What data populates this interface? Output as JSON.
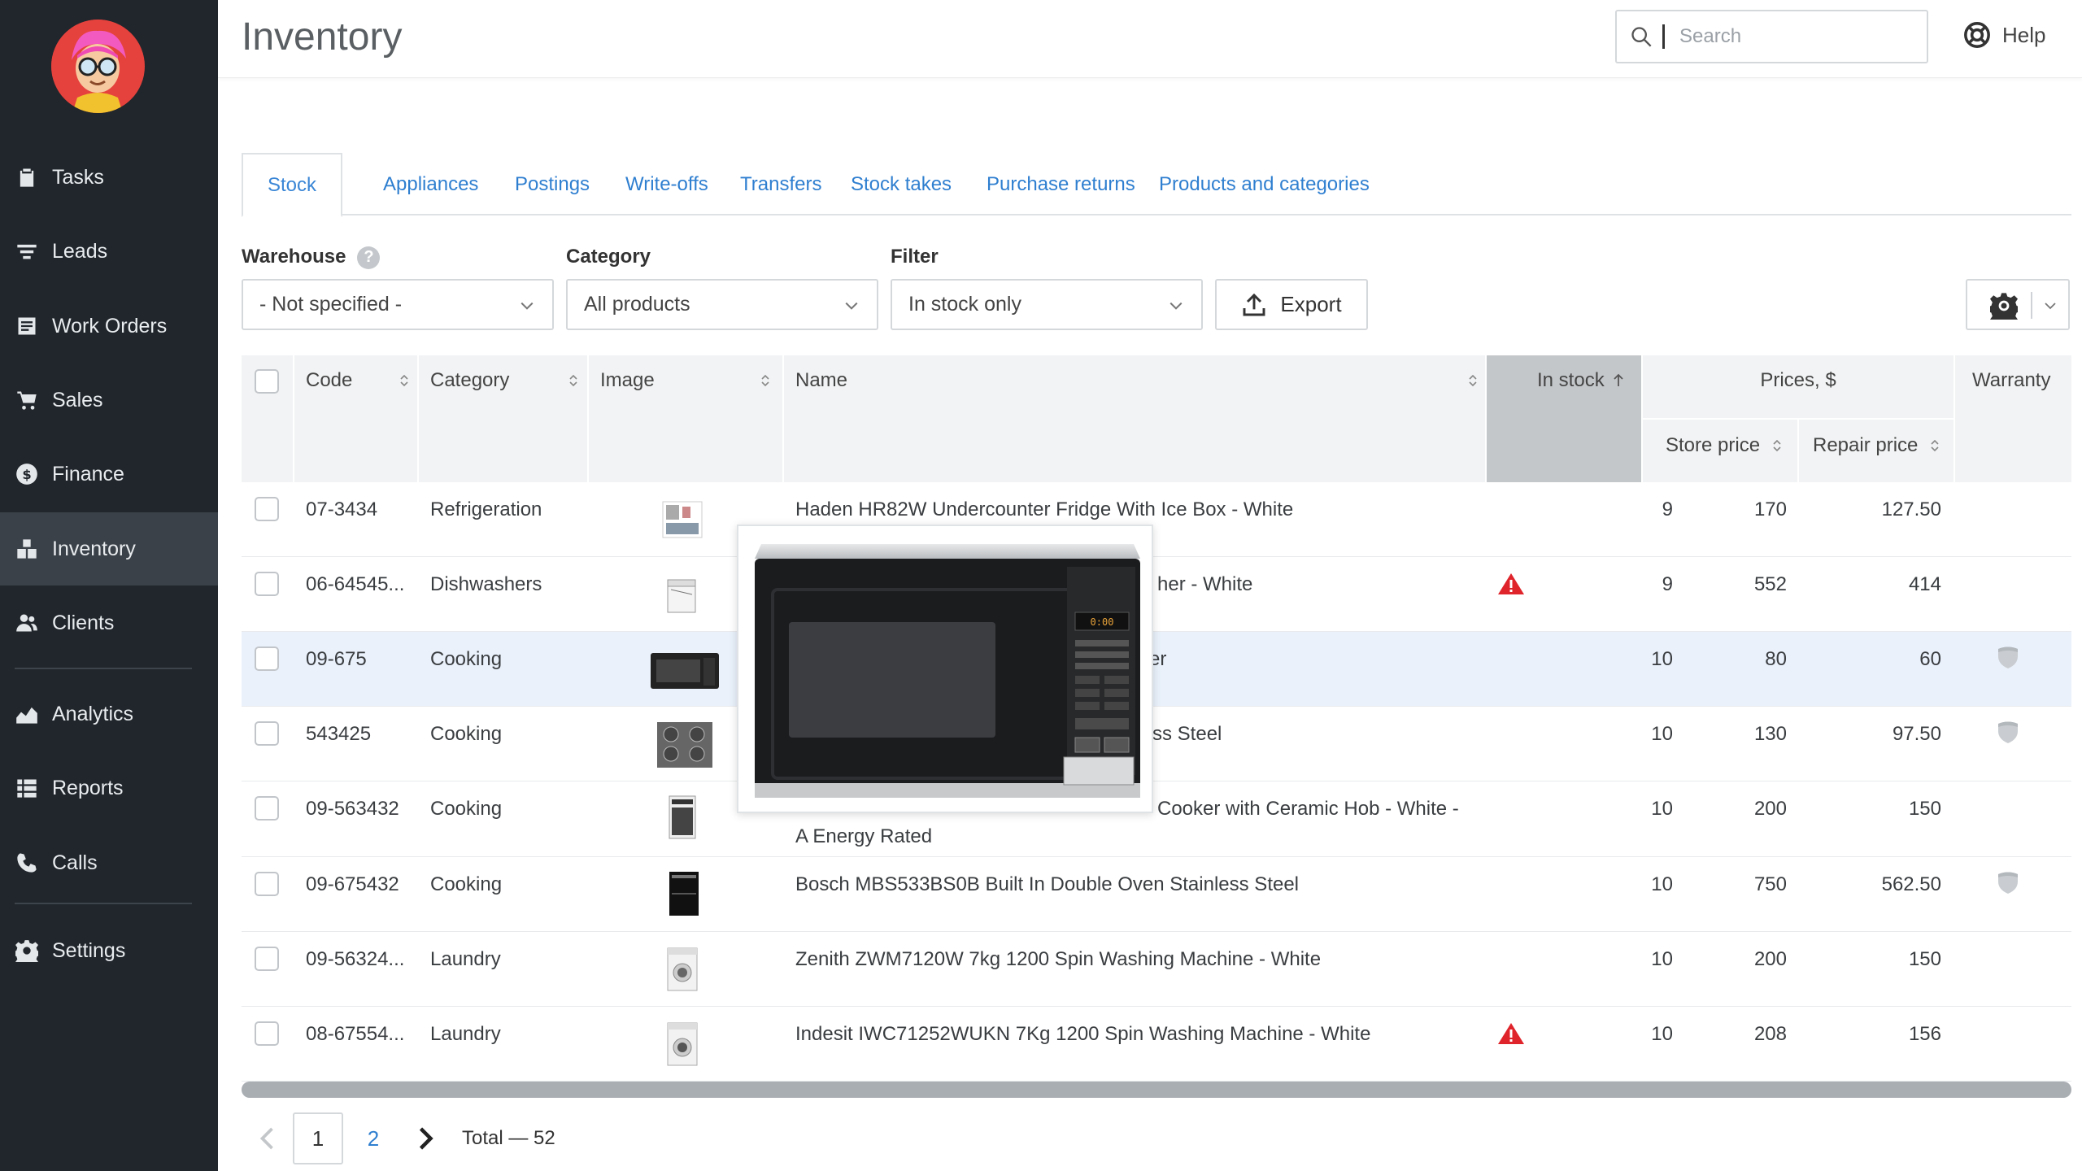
{
  "sidebar": {
    "items": [
      {
        "label": "Tasks",
        "icon": "clipboard-icon"
      },
      {
        "label": "Leads",
        "icon": "funnel-icon"
      },
      {
        "label": "Work Orders",
        "icon": "document-icon"
      },
      {
        "label": "Sales",
        "icon": "cart-icon"
      },
      {
        "label": "Finance",
        "icon": "dollar-icon"
      },
      {
        "label": "Inventory",
        "icon": "boxes-icon"
      },
      {
        "label": "Clients",
        "icon": "users-icon"
      },
      {
        "label": "Analytics",
        "icon": "area-chart-icon"
      },
      {
        "label": "Reports",
        "icon": "list-icon"
      },
      {
        "label": "Calls",
        "icon": "phone-icon"
      },
      {
        "label": "Settings",
        "icon": "gear-icon"
      }
    ],
    "active": "Inventory"
  },
  "header": {
    "title": "Inventory",
    "search_placeholder": "Search",
    "help_label": "Help"
  },
  "tabs": [
    {
      "label": "Stock",
      "active": true
    },
    {
      "label": "Appliances"
    },
    {
      "label": "Postings"
    },
    {
      "label": "Write-offs"
    },
    {
      "label": "Transfers"
    },
    {
      "label": "Stock takes"
    },
    {
      "label": "Purchase returns"
    },
    {
      "label": "Products and categories"
    }
  ],
  "filters": {
    "warehouse_label": "Warehouse",
    "warehouse_help": "?",
    "warehouse_value": "- Not specified -",
    "category_label": "Category",
    "category_value": "All products",
    "filter_label": "Filter",
    "filter_value": "In stock only",
    "export_label": "Export"
  },
  "table": {
    "columns": {
      "code": "Code",
      "category": "Category",
      "image": "Image",
      "name": "Name",
      "in_stock": "In stock",
      "prices": "Prices, $",
      "store_price": "Store price",
      "repair_price": "Repair price",
      "warranty": "Warranty"
    },
    "rows": [
      {
        "code": "07-3434",
        "category": "Refrigeration",
        "name": "Haden HR82W Undercounter Fridge With Ice Box - White",
        "in_stock": "9",
        "store_price": "170",
        "repair_price": "127.50",
        "warning": false,
        "warranty": false
      },
      {
        "code": "06-64545...",
        "category": "Dishwashers",
        "name": "her - White",
        "in_stock": "9",
        "store_price": "552",
        "repair_price": "414",
        "warning": true,
        "warranty": false
      },
      {
        "code": "09-675",
        "category": "Cooking",
        "name": "er",
        "in_stock": "10",
        "store_price": "80",
        "repair_price": "60",
        "warning": false,
        "warranty": true
      },
      {
        "code": "543425",
        "category": "Cooking",
        "name": "ss Steel",
        "in_stock": "10",
        "store_price": "130",
        "repair_price": "97.50",
        "warning": false,
        "warranty": true
      },
      {
        "code": "09-563432",
        "category": "Cooking",
        "name": "Cooker with Ceramic Hob - White -",
        "name_line2": "A Energy Rated",
        "in_stock": "10",
        "store_price": "200",
        "repair_price": "150",
        "warning": false,
        "warranty": false
      },
      {
        "code": "09-675432",
        "category": "Cooking",
        "name": "Bosch MBS533BS0B Built In Double Oven Stainless Steel",
        "in_stock": "10",
        "store_price": "750",
        "repair_price": "562.50",
        "warning": false,
        "warranty": true
      },
      {
        "code": "09-56324...",
        "category": "Laundry",
        "name": "Zenith ZWM7120W 7kg 1200 Spin Washing Machine - White",
        "in_stock": "10",
        "store_price": "200",
        "repair_price": "150",
        "warning": false,
        "warranty": false
      },
      {
        "code": "08-67554...",
        "category": "Laundry",
        "name": "Indesit IWC71252WUKN 7Kg 1200 Spin Washing Machine - White",
        "in_stock": "10",
        "store_price": "208",
        "repair_price": "156",
        "warning": true,
        "warranty": false
      }
    ]
  },
  "pagination": {
    "pages": [
      "1",
      "2"
    ],
    "current": "1",
    "total": "Total — 52"
  },
  "colors": {
    "sidebar_bg": "#20262c",
    "sidebar_active": "#3a4148",
    "link": "#2f7fd0",
    "warning": "#e0242b",
    "highlight_row": "#eaf1fb"
  }
}
